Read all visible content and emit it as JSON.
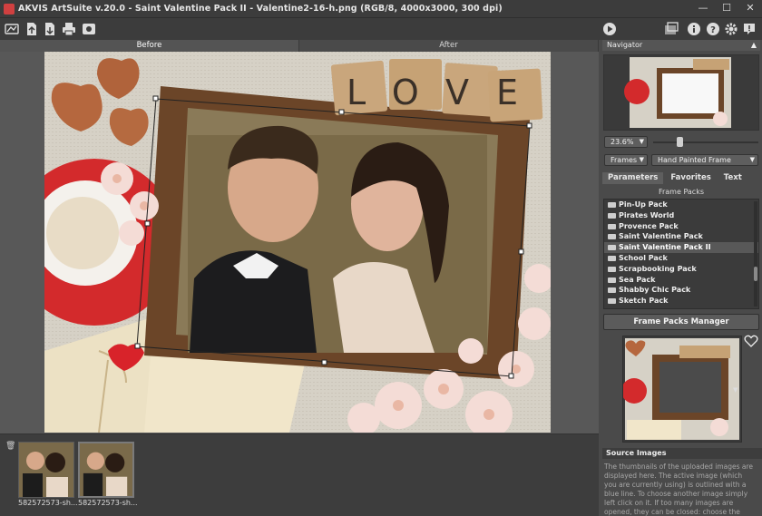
{
  "window": {
    "title": "AKVIS ArtSuite v.20.0 - Saint Valentine Pack II - Valentine2-16-h.png (RGB/8, 4000x3000, 300 dpi)"
  },
  "toolbar": {
    "icons": [
      "open-icon",
      "export-icon",
      "save-icon",
      "print-icon",
      "plugin-icon"
    ],
    "right_icons": [
      "run-icon",
      "canvas-icon",
      "info-icon",
      "help-icon",
      "settings-icon",
      "notify-icon"
    ]
  },
  "view_tabs": {
    "before": "Before",
    "after": "After"
  },
  "photo": {
    "overlay_word": "LOVE"
  },
  "navigator": {
    "title": "Navigator",
    "zoom": "23.6%",
    "zoom_level": 0.236
  },
  "effect": {
    "category": "Frames",
    "type": "Hand Painted Frame"
  },
  "panel_tabs": {
    "parameters": "Parameters",
    "favorites": "Favorites",
    "text": "Text"
  },
  "frame_packs": {
    "title": "Frame Packs",
    "items": [
      "Pin-Up Pack",
      "Pirates World",
      "Provence Pack",
      "Saint Valentine Pack",
      "Saint Valentine Pack II",
      "School Pack",
      "Scrapbooking Pack",
      "Sea Pack",
      "Shabby Chic Pack",
      "Sketch Pack"
    ],
    "selected_index": 4,
    "manager_button": "Frame Packs Manager"
  },
  "thumbnails": [
    {
      "caption": "582572573-sh..."
    },
    {
      "caption": "582572573-sh..."
    }
  ],
  "source_images": {
    "title": "Source Images",
    "text": "The thumbnails of the uploaded images are displayed here. The active image (which you are currently using) is outlined with a blue line. To choose another image simply left click on it. If too many images are opened, they can be closed: choose the unnecessary images and press the button \"Remove\" or use the Delete-key."
  },
  "colors": {
    "accent": "#585858",
    "panel": "#4a4a4a",
    "heart_red": "#d8232a"
  }
}
